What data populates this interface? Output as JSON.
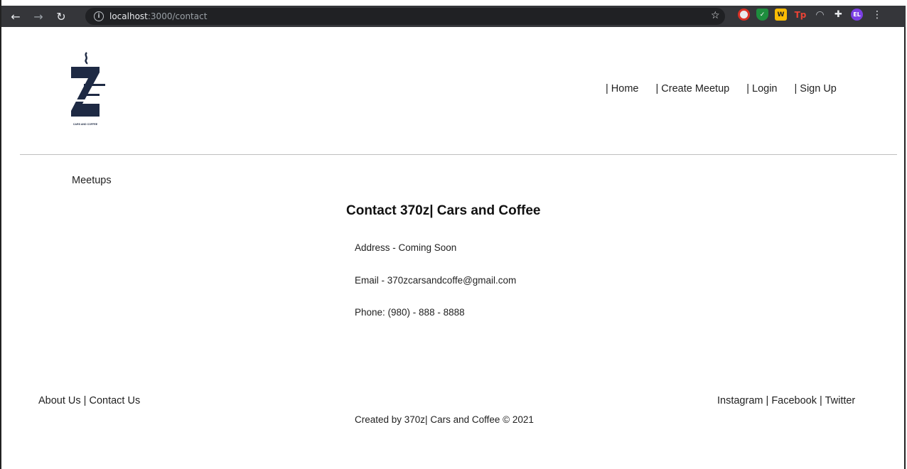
{
  "browser": {
    "url_host": "localhost",
    "url_path": ":3000/contact",
    "profile_initials": "EL",
    "extensions": [
      "block-icon",
      "shield-icon",
      "w-icon",
      "tp-icon",
      "arc-icon",
      "puzzle-icon"
    ],
    "ext_labels": {
      "w": "W",
      "tp": "Tp"
    }
  },
  "header": {
    "logo_letter": "Z",
    "logo_tagline": "CARS AND COFFEE",
    "nav": [
      "| Home",
      "| Create Meetup",
      "| Login",
      "| Sign Up"
    ]
  },
  "sidebar": {
    "meetups_label": "Meetups"
  },
  "main": {
    "title": "Contact 370z| Cars and Coffee",
    "address": "Address - Coming Soon",
    "email": "Email - 370zcarsandcoffe@gmail.com",
    "phone": "Phone: (980) - 888 - 8888"
  },
  "footer": {
    "about": "About Us",
    "separator": " | ",
    "contact": "Contact Us",
    "instagram": "Instagram",
    "facebook": "Facebook",
    "twitter": "Twitter",
    "copyright": "Created by 370z| Cars and Coffee © 2021"
  },
  "colors": {
    "logo_navy": "#1e2a44",
    "chrome_bg": "#35363a",
    "divider": "#bfbfbf"
  }
}
